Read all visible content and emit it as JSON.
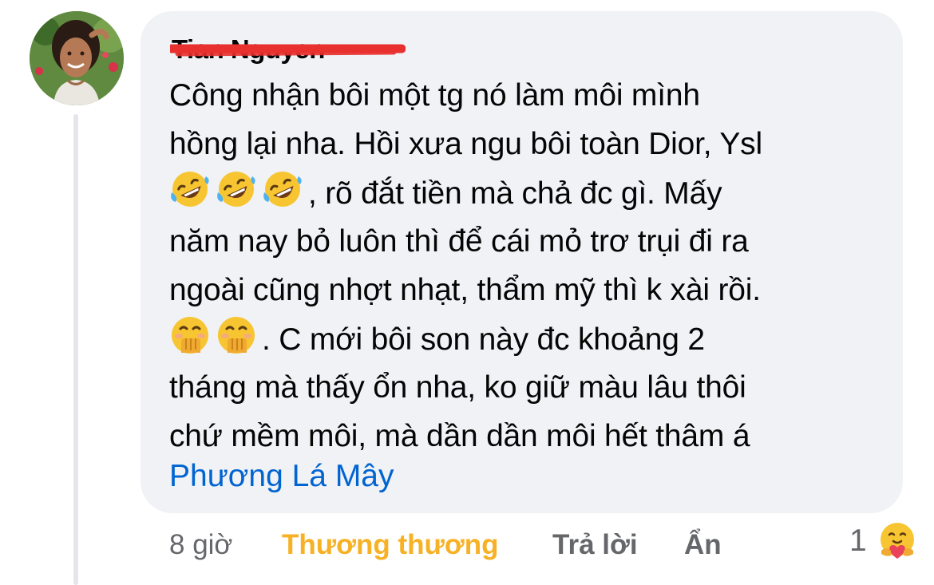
{
  "comment": {
    "author_name": "Tian    Nguyen",
    "text_lines": [
      "Công nhận bôi một tg nó làm môi mình",
      "hồng lại nha. Hồi xưa ngu bôi toàn Dior, Ysl",
      ", rõ đắt tiền mà chả đc gì. Mấy",
      "năm nay bỏ luôn thì để cái mỏ trơ trụi đi ra",
      "ngoài cũng nhợt nhạt, thẩm mỹ thì k xài rồi.",
      ". C mới bôi son này đc khoảng 2",
      "tháng mà thấy ổn nha, ko giữ màu lâu thôi",
      "chứ mềm môi, mà dần dần môi hết thâm á"
    ],
    "mention": "Phương Lá Mây",
    "emojis_line3": [
      "rofl-emoji",
      "rofl-emoji",
      "rofl-emoji"
    ],
    "emojis_line6": [
      "hand-over-mouth-emoji",
      "hand-over-mouth-emoji"
    ]
  },
  "actions": {
    "time": "8 giờ",
    "reaction_label": "Thương thương",
    "reply": "Trả lời",
    "hide": "Ẩn"
  },
  "reaction": {
    "count": "1",
    "icon": "care-reaction-icon"
  },
  "colors": {
    "bubble": "#f0f2f5",
    "text": "#050505",
    "secondary": "#65676b",
    "mention": "#0064d1",
    "reaction_label": "#f7b125",
    "redaction": "#e8302e"
  }
}
